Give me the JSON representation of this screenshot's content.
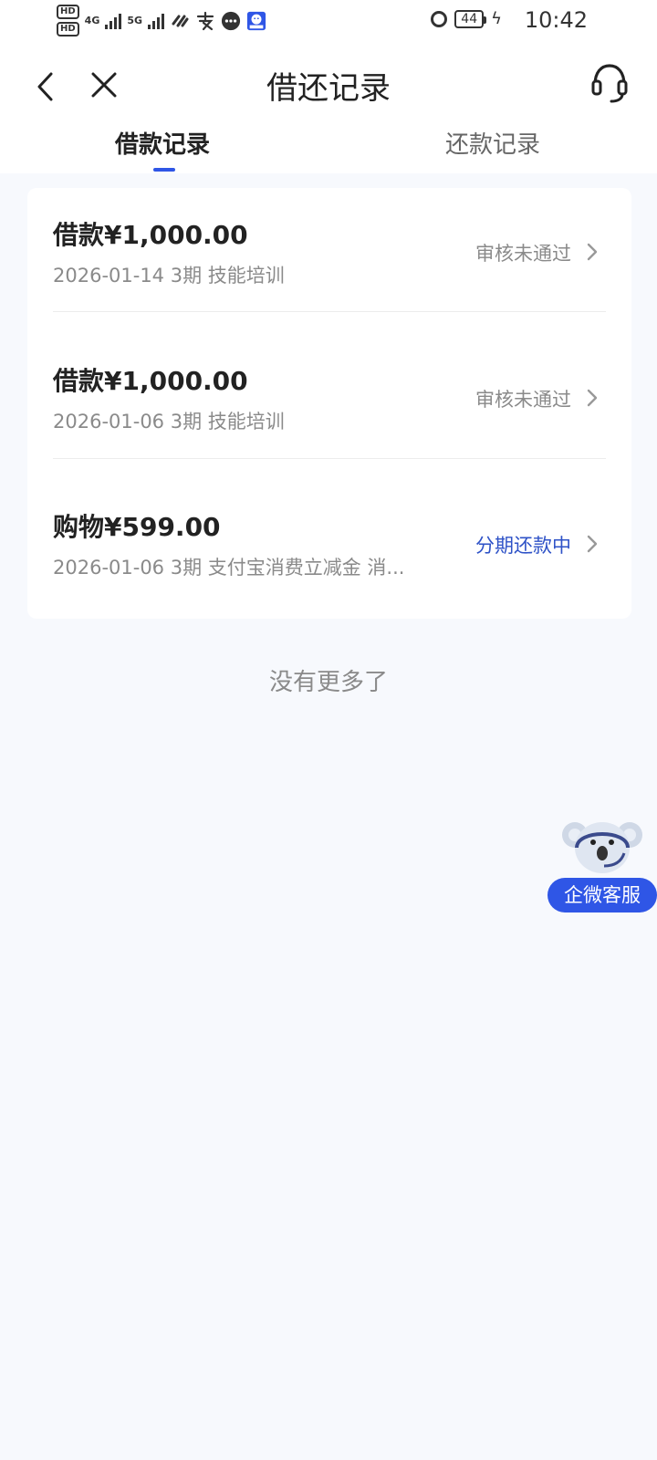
{
  "status_bar": {
    "hd1": "HD",
    "hd2": "HD",
    "net1": "4G",
    "net2": "5G",
    "battery": "44",
    "time": "10:42"
  },
  "nav": {
    "title": "借还记录",
    "back_icon": "chevron-left-icon",
    "close_icon": "close-icon",
    "support_icon": "headset-icon"
  },
  "tabs": [
    {
      "label": "借款记录",
      "active": true
    },
    {
      "label": "还款记录",
      "active": false
    }
  ],
  "records": [
    {
      "title": "借款¥1,000.00",
      "meta": "2026-01-14 3期  技能培训",
      "status": "审核未通过",
      "status_color": "#8a8a8a"
    },
    {
      "title": "借款¥1,000.00",
      "meta": "2026-01-06 3期  技能培训",
      "status": "审核未通过",
      "status_color": "#8a8a8a"
    },
    {
      "title": "购物¥599.00",
      "meta": "2026-01-06 3期  支付宝消费立减金 消...",
      "status": "分期还款中",
      "status_color": "#2e52c7"
    }
  ],
  "end_note": "没有更多了",
  "float_service": {
    "label": "企微客服",
    "icon": "koala-mascot-icon"
  },
  "colors": {
    "accent": "#2f56e6",
    "background": "#f7f9fd",
    "status_active": "#2e52c7"
  }
}
